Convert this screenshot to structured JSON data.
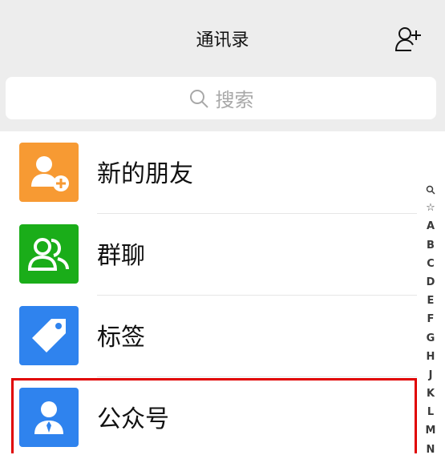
{
  "header": {
    "title": "通讯录",
    "add_friend_icon": "add-friend-icon"
  },
  "search": {
    "placeholder": "搜索",
    "icon": "search-icon"
  },
  "items": [
    {
      "label": "新的朋友",
      "icon": "new-friend-icon",
      "color": "#f79a33"
    },
    {
      "label": "群聊",
      "icon": "group-chat-icon",
      "color": "#1aad19"
    },
    {
      "label": "标签",
      "icon": "tag-icon",
      "color": "#2f83ee"
    },
    {
      "label": "公众号",
      "icon": "official-account-icon",
      "color": "#2f83ee"
    }
  ],
  "index_bar": {
    "letters": [
      "☆",
      "A",
      "B",
      "C",
      "D",
      "E",
      "F",
      "G",
      "H",
      "J",
      "K",
      "L",
      "M",
      "N"
    ],
    "search_symbol_icon": "search-icon"
  },
  "colors": {
    "header_bg": "#ededed",
    "highlight": "#e00000"
  }
}
